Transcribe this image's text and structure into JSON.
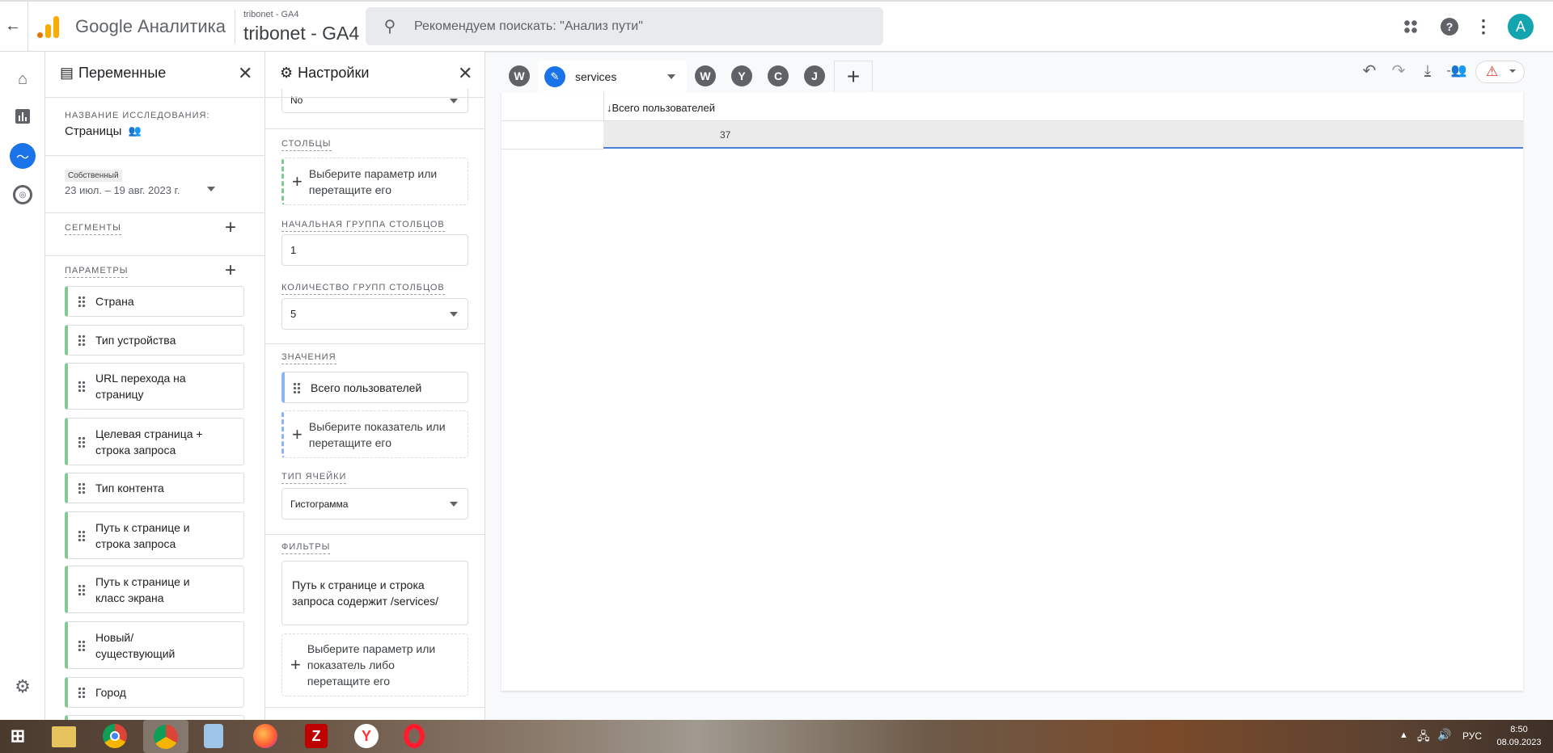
{
  "header": {
    "app_name": "Google Аналитика",
    "account_small": "tribonet - GA4",
    "property": "tribonet - GA4",
    "search_placeholder": "Рекомендуем поискать: \"Анализ пути\"",
    "avatar_letter": "A",
    "avatar_color": "#12a4af",
    "logo_colors": [
      "#f9ab00",
      "#e37400"
    ]
  },
  "variables": {
    "title": "Переменные",
    "exploration_label": "НАЗВАНИЕ ИССЛЕДОВАНИЯ:",
    "exploration_name": "Страницы",
    "date_chip": "Собственный",
    "date_range": "23 июл. – 19 авг. 2023 г.",
    "segments_label": "СЕГМЕНТЫ",
    "params_label": "ПАРАМЕТРЫ",
    "params": [
      "Страна",
      "Тип устройства",
      "URL перехода на страницу",
      "Целевая страница + строка запроса",
      "Тип контента",
      "Путь к странице и строка запроса",
      "Путь к странице и класс экрана",
      "Новый/ существующий",
      "Город"
    ]
  },
  "settings": {
    "title": "Настройки",
    "top_select": "No",
    "columns_label": "СТОЛБЦЫ",
    "columns_drop": "Выберите параметр или перетащите его",
    "start_group_label": "НАЧАЛЬНАЯ ГРУППА СТОЛБЦОВ",
    "start_group_value": "1",
    "group_count_label": "КОЛИЧЕСТВО ГРУПП СТОЛБЦОВ",
    "group_count_value": "5",
    "values_label": "ЗНАЧЕНИЯ",
    "value_item": "Всего пользователей",
    "values_drop": "Выберите показатель или перетащите его",
    "cell_type_label": "ТИП ЯЧЕЙКИ",
    "cell_type_value": "Гистограмма",
    "filters_label": "ФИЛЬТРЫ",
    "filter_item": "Путь к странице и строка запроса содержит /services/",
    "filters_drop": "Выберите параметр или показатель либо перетащите его"
  },
  "tabs": {
    "first": "W",
    "active": "services",
    "others": [
      "W",
      "Y",
      "C",
      "J"
    ]
  },
  "table": {
    "column_header": "Всего пользователей",
    "value": "37",
    "accent": "#4a7fd4"
  },
  "taskbar": {
    "lang": "РУС",
    "time": "8:50",
    "date": "08.09.2023"
  }
}
